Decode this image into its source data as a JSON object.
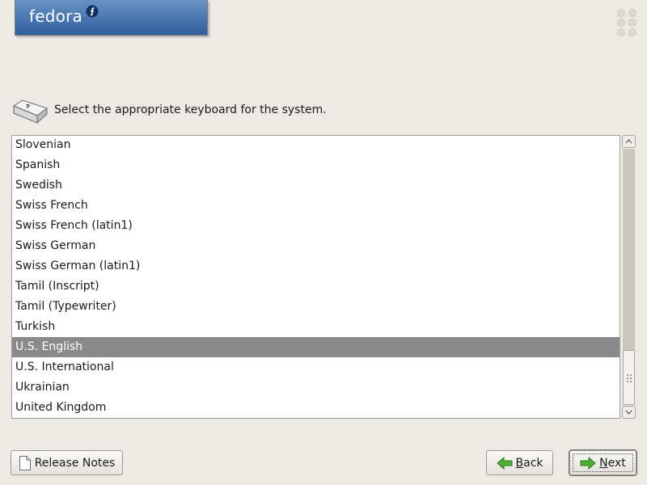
{
  "banner": {
    "logo_text": "fedora"
  },
  "prompt": {
    "text": "Select the appropriate keyboard for the system.",
    "icon": "keyboard-key-icon"
  },
  "keyboard_list": {
    "items": [
      "Slovenian",
      "Spanish",
      "Swedish",
      "Swiss French",
      "Swiss French (latin1)",
      "Swiss German",
      "Swiss German (latin1)",
      "Tamil (Inscript)",
      "Tamil (Typewriter)",
      "Turkish",
      "U.S. English",
      "U.S. International",
      "Ukrainian",
      "United Kingdom"
    ],
    "selected": "U.S. English"
  },
  "buttons": {
    "release_notes": {
      "label": "Release Notes",
      "icon": "document-icon"
    },
    "back": {
      "mnemonic": "B",
      "rest": "ack",
      "icon": "back-arrow-icon"
    },
    "next": {
      "mnemonic": "N",
      "rest": "ext",
      "icon": "next-arrow-icon"
    }
  },
  "colors": {
    "background": "#edeae5",
    "banner": "#2e5f9d",
    "selection": "#8a8a8a",
    "arrow_green": "#3e9a2c"
  }
}
